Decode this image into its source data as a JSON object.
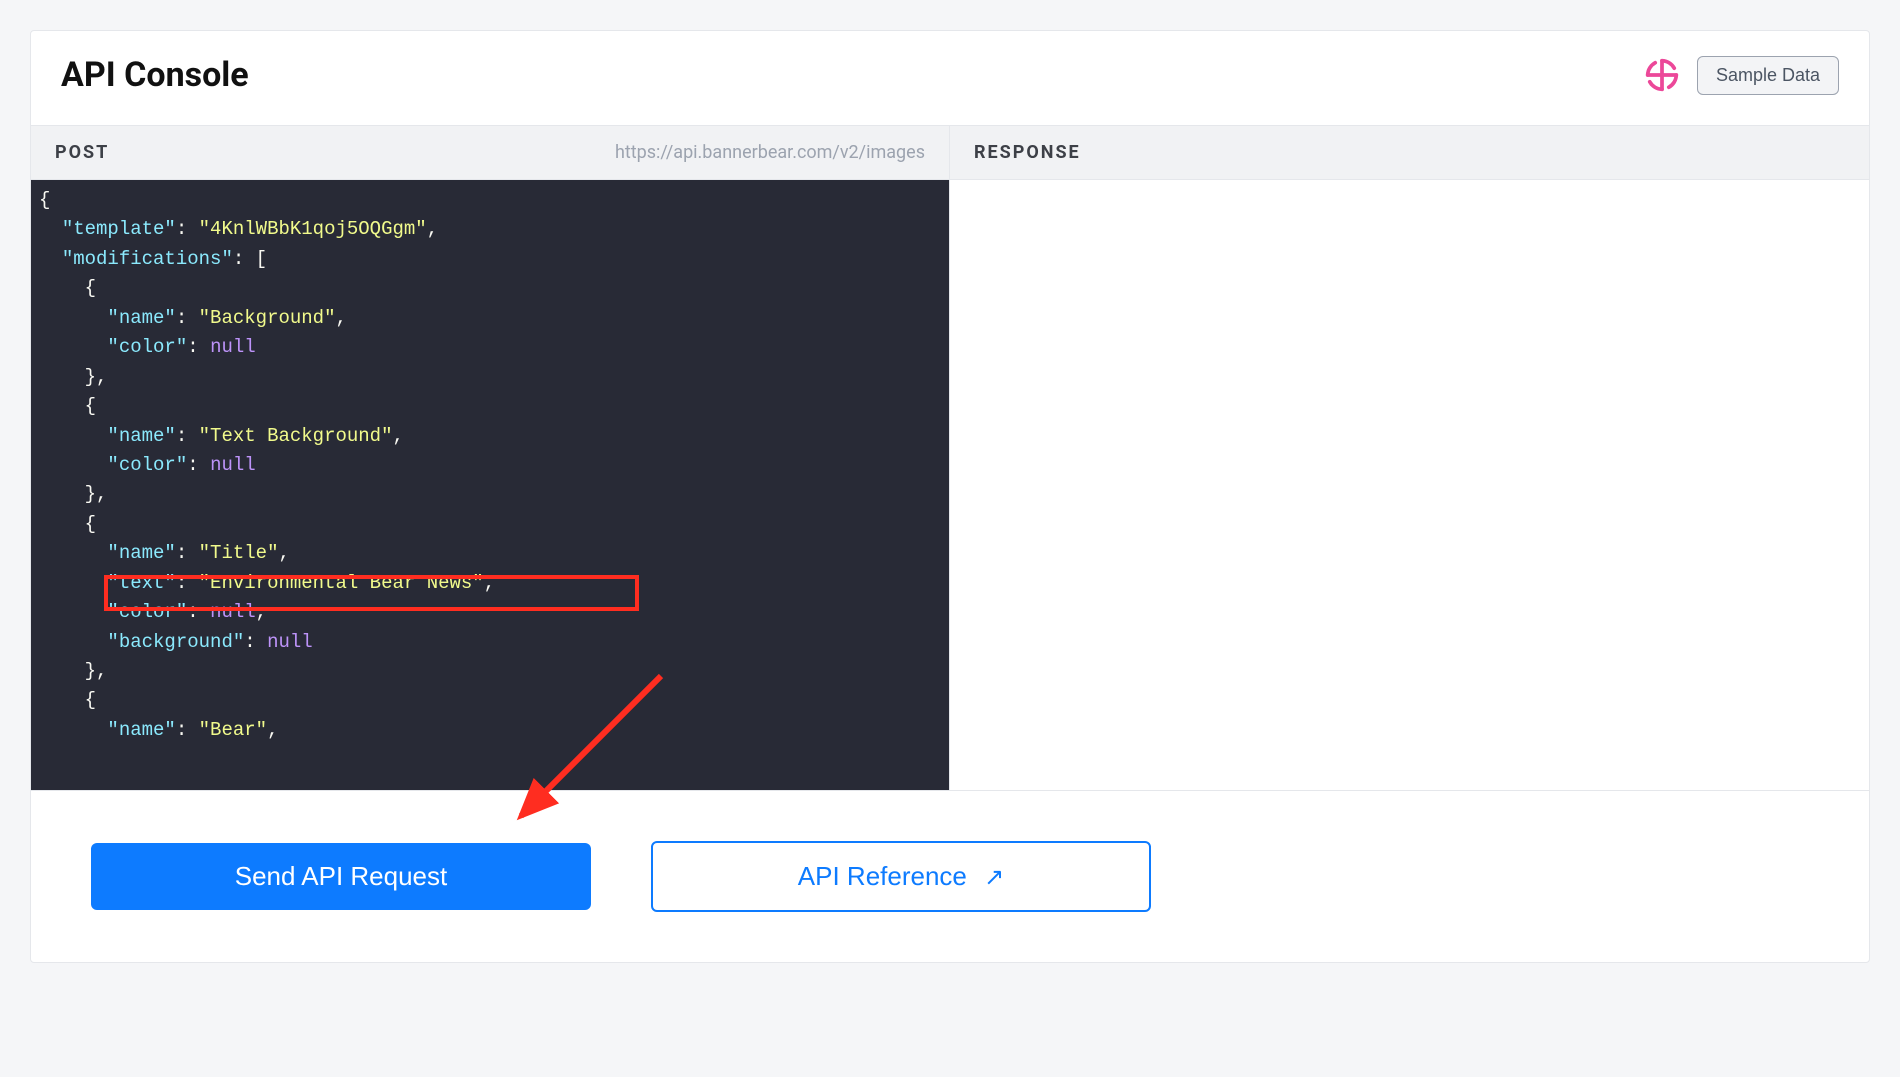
{
  "header": {
    "title": "API Console",
    "sample_data_label": "Sample Data"
  },
  "post_panel": {
    "label": "POST",
    "url": "https://api.bannerbear.com/v2/images"
  },
  "response_panel": {
    "label": "RESPONSE"
  },
  "request_body": {
    "template": "4KnlWBbK1qoj5OQGgm",
    "modifications": [
      {
        "name": "Background",
        "color": null
      },
      {
        "name": "Text Background",
        "color": null
      },
      {
        "name": "Title",
        "text": "Environmental Bear News",
        "color": null,
        "background": null
      },
      {
        "name": "Bear"
      }
    ]
  },
  "code_tokens": {
    "template_key": "\"template\"",
    "template_val": "\"4KnlWBbK1qoj5OQGgm\"",
    "modifications_key": "\"modifications\"",
    "name_key": "\"name\"",
    "color_key": "\"color\"",
    "text_key": "\"text\"",
    "background_key": "\"background\"",
    "null_val": "null",
    "val_background": "\"Background\"",
    "val_text_background": "\"Text Background\"",
    "val_title": "\"Title\"",
    "val_env_bear_news": "\"Environmental Bear News\"",
    "val_bear": "\"Bear\""
  },
  "footer": {
    "send_label": "Send API Request",
    "ref_label": "API Reference"
  }
}
